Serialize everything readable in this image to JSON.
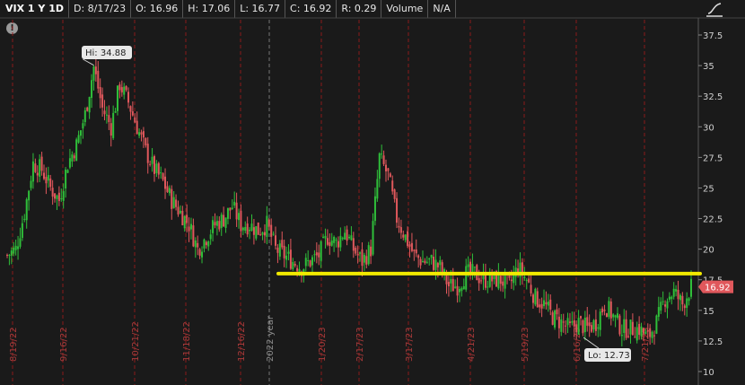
{
  "header": {
    "symbol": "VIX 1 Y 1D",
    "date": "D: 8/17/23",
    "open": "O: 16.96",
    "high": "H: 17.06",
    "low": "L: 16.77",
    "close": "C: 16.92",
    "range": "R: 0.29",
    "volume_label": "Volume",
    "volume_value": "N/A"
  },
  "alert_icon": "!",
  "colors": {
    "up": "#2fbf3a",
    "down": "#e0585c",
    "support": "#f2ea00",
    "grid": "#8a1a1a",
    "price_tag": "#e0585c"
  },
  "chart_data": {
    "type": "candlestick",
    "ylim": [
      10,
      38.5
    ],
    "y_ticks": [
      "37.5",
      "35",
      "32.5",
      "30",
      "27.5",
      "25",
      "22.5",
      "20",
      "17.5",
      "15",
      "12.5",
      "10"
    ],
    "x_labels": [
      "8/19/22",
      "9/16/22",
      "10/21/22",
      "11/18/22",
      "12/16/22",
      "2022 year",
      "1/20/23",
      "2/17/23",
      "3/17/23",
      "4/21/23",
      "5/19/23",
      "6/16/23",
      "7/21/23"
    ],
    "year_separator": "2022 year",
    "hi_label": "Hi: 34.88",
    "lo_label": "Lo: 12.73",
    "last_price": "16.92",
    "support_level": 18,
    "close_path": [
      [
        0,
        19.5
      ],
      [
        4,
        20
      ],
      [
        8,
        23
      ],
      [
        12,
        27
      ],
      [
        16,
        26.5
      ],
      [
        20,
        25
      ],
      [
        24,
        24
      ],
      [
        28,
        27
      ],
      [
        32,
        28.5
      ],
      [
        36,
        31
      ],
      [
        40,
        34.88
      ],
      [
        44,
        31.5
      ],
      [
        48,
        30
      ],
      [
        52,
        33.5
      ],
      [
        56,
        32
      ],
      [
        60,
        30
      ],
      [
        64,
        28
      ],
      [
        68,
        26.5
      ],
      [
        72,
        25.5
      ],
      [
        76,
        24
      ],
      [
        80,
        23
      ],
      [
        84,
        22
      ],
      [
        88,
        20
      ],
      [
        92,
        21
      ],
      [
        96,
        22
      ],
      [
        100,
        22.5
      ],
      [
        104,
        23.5
      ],
      [
        108,
        22
      ],
      [
        112,
        22
      ],
      [
        116,
        21.5
      ],
      [
        120,
        22
      ],
      [
        124,
        20
      ],
      [
        128,
        19.5
      ],
      [
        132,
        19
      ],
      [
        136,
        18.5
      ],
      [
        140,
        19
      ],
      [
        144,
        19.5
      ],
      [
        148,
        21
      ],
      [
        152,
        20.5
      ],
      [
        156,
        21.5
      ],
      [
        160,
        20
      ],
      [
        164,
        19
      ],
      [
        168,
        20
      ],
      [
        172,
        27.5
      ],
      [
        176,
        26
      ],
      [
        180,
        22.5
      ],
      [
        184,
        21
      ],
      [
        188,
        19.5
      ],
      [
        192,
        19
      ],
      [
        196,
        19
      ],
      [
        200,
        18.5
      ],
      [
        204,
        17
      ],
      [
        208,
        17
      ],
      [
        212,
        18
      ],
      [
        216,
        18
      ],
      [
        220,
        17.5
      ],
      [
        224,
        17.5
      ],
      [
        228,
        17.5
      ],
      [
        232,
        17
      ],
      [
        236,
        18.5
      ],
      [
        240,
        17.5
      ],
      [
        244,
        16
      ],
      [
        248,
        15.5
      ],
      [
        252,
        14.5
      ],
      [
        256,
        14
      ],
      [
        260,
        13.5
      ],
      [
        264,
        14
      ],
      [
        268,
        13.5
      ],
      [
        272,
        14
      ],
      [
        276,
        15.5
      ],
      [
        280,
        14.5
      ],
      [
        284,
        13.5
      ],
      [
        288,
        13.5
      ],
      [
        292,
        13.5
      ],
      [
        296,
        12.73
      ],
      [
        300,
        14
      ],
      [
        304,
        16
      ],
      [
        308,
        16.5
      ],
      [
        312,
        15.5
      ],
      [
        316,
        16.92
      ]
    ]
  }
}
